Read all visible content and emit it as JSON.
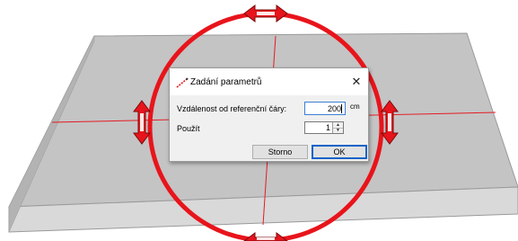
{
  "dialog": {
    "title": "Zadání parametrů",
    "close_label": "✕",
    "distance_label": "Vzdálenost od referenční čáry:",
    "distance_value": "200",
    "distance_unit": "cm",
    "use_label": "Použít",
    "use_value": "1",
    "spin_up": "▲",
    "spin_down": "▼",
    "cancel_label": "Storno",
    "ok_label": "OK"
  },
  "colors": {
    "ring": "#e8141b",
    "slab_top": "#c4c4c4",
    "slab_side": "#d9d9d9",
    "guide": "#e31b23"
  },
  "icons": [
    "pencil-icon",
    "close-icon",
    "resize-handle-icon"
  ]
}
